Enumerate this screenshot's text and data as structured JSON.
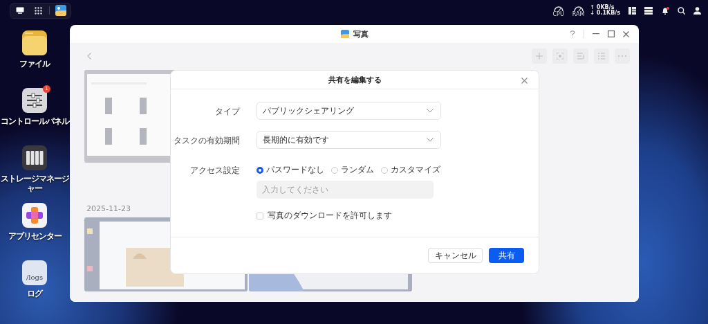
{
  "status": {
    "cpu_label": "CPU",
    "ram_label": "RAM",
    "upload": "↑ 0KB/s",
    "download": "↓ 0.1KB/s",
    "notification_dot": true
  },
  "desktop_icons": [
    {
      "label": "ファイル",
      "kind": "folder"
    },
    {
      "label": "コントロールパネル",
      "kind": "control",
      "badge": "1"
    },
    {
      "label": "ストレージマネージャー",
      "kind": "storage"
    },
    {
      "label": "アプリセンター",
      "kind": "apps"
    },
    {
      "label": "ログ",
      "kind": "logs",
      "icon_text": "/logs"
    }
  ],
  "window": {
    "title": "写真"
  },
  "photos": {
    "groups": [
      {
        "items": [
          {
            "kind": "picture"
          }
        ]
      },
      {
        "date": "2025-11-23",
        "items": [
          {
            "kind": "picture"
          },
          {
            "kind": "picture"
          }
        ]
      }
    ]
  },
  "dialog": {
    "title": "共有を編集する",
    "fields": [
      {
        "kind": "select",
        "label": "タイプ",
        "value": "パブリックシェアリング"
      },
      {
        "kind": "select",
        "label": "タスクの有効期間",
        "value": "長期的に有効です"
      },
      {
        "kind": "radio",
        "label": "アクセス設定",
        "options": [
          {
            "label": "パスワードなし",
            "selected": true
          },
          {
            "label": "ランダム",
            "selected": false
          },
          {
            "label": "カスタマイズ",
            "selected": false
          }
        ],
        "input": {
          "placeholder": "入力してください",
          "disabled": true
        }
      },
      {
        "kind": "checkbox",
        "label": "写真のダウンロードを許可します",
        "checked": false
      }
    ],
    "buttons": [
      {
        "label": "キャンセル",
        "kind": "secondary"
      },
      {
        "label": "共有",
        "kind": "primary"
      }
    ]
  }
}
